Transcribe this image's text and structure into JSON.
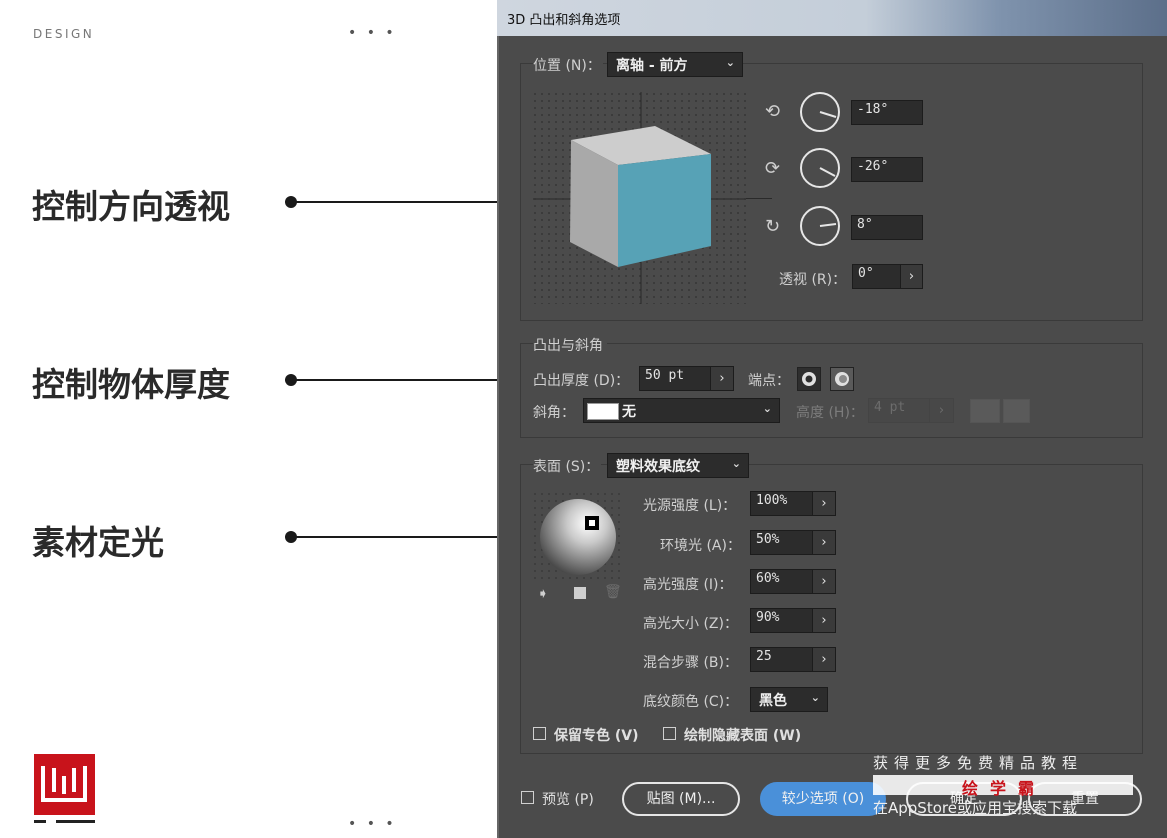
{
  "slide": {
    "design_label": "DESIGN",
    "dots_label": "• • •",
    "annotations": [
      "控制方向透视",
      "控制物体厚度",
      "素材定光"
    ]
  },
  "dialog": {
    "title": "3D 凸出和斜角选项",
    "position": {
      "label": "位置 (N)：",
      "value": "离轴 - 前方",
      "rotations": [
        {
          "icon": "x-axis-rotate-icon",
          "glyph": "⟲",
          "value": "-18°"
        },
        {
          "icon": "y-axis-rotate-icon",
          "glyph": "⟳",
          "value": "-26°"
        },
        {
          "icon": "z-axis-rotate-icon",
          "glyph": "↻",
          "value": "8°"
        }
      ],
      "perspective_label": "透视 (R)：",
      "perspective_value": "0°"
    },
    "extrude": {
      "section_label": "凸出与斜角",
      "depth_label": "凸出厚度 (D)：",
      "depth_value": "50 pt",
      "cap_label": "端点：",
      "bevel_label": "斜角：",
      "bevel_value": "无",
      "height_label": "高度 (H)：",
      "height_value": "4 pt"
    },
    "surface": {
      "label": "表面 (S)：",
      "value": "塑料效果底纹",
      "light_intensity_label": "光源强度 (L)：",
      "light_intensity_value": "100%",
      "ambient_label": "环境光 (A)：",
      "ambient_value": "50%",
      "highlight_intensity_label": "高光强度 (I)：",
      "highlight_intensity_value": "60%",
      "highlight_size_label": "高光大小 (Z)：",
      "highlight_size_value": "90%",
      "blend_steps_label": "混合步骤 (B)：",
      "blend_steps_value": "25",
      "shade_color_label": "底纹颜色 (C)：",
      "shade_color_value": "黑色",
      "preserve_spot_label": "保留专色 (V)",
      "draw_hidden_label": "绘制隐藏表面 (W)"
    },
    "footer": {
      "preview_label": "预览 (P)",
      "map_art_label": "贴图 (M)...",
      "fewer_options_label": "较少选项 (O)",
      "ok_label": "确定",
      "reset_label": "重置"
    },
    "step_glyph": "›",
    "chev_glyph": "⌄"
  },
  "watermark": {
    "top": "获得更多免费精品教程",
    "brand": "绘学霸",
    "bottom": "在AppStore或应用宝搜索下载"
  },
  "colors": {
    "accent_blue": "#4a90d9",
    "cube_front": "#57a2b6",
    "logo_red": "#c8131b"
  }
}
